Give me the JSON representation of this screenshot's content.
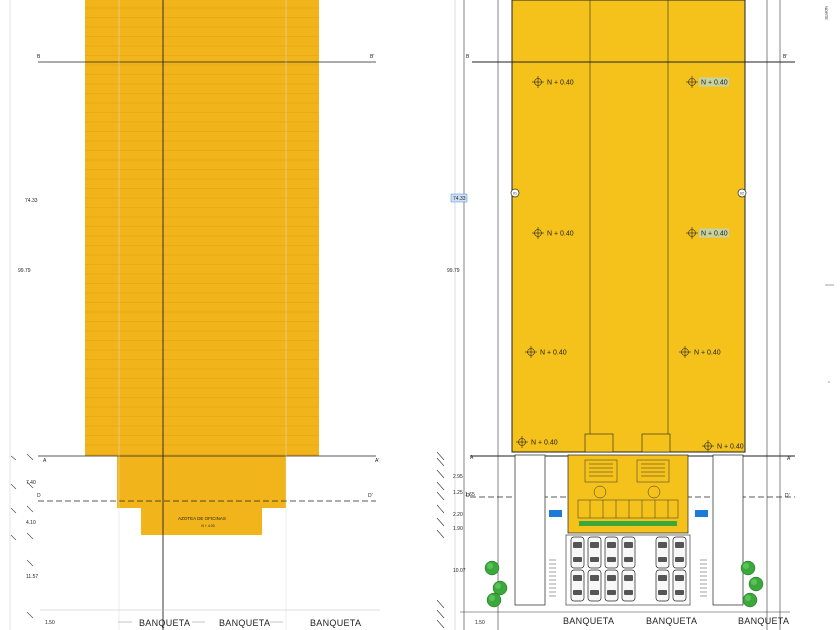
{
  "colors": {
    "roof_left": "#f2b41b",
    "roof_right": "#f4c21a",
    "line": "#222222",
    "highlight": "#c8d2a0",
    "sel_blue": "#1c7bd6",
    "tree_green": "#3aa83a"
  },
  "left_plan": {
    "section_marks": {
      "a": "A",
      "a_prime": "A'",
      "b": "B",
      "b_prime": "B'",
      "d": "D",
      "d_prime": "D'"
    },
    "dims": {
      "d1": "74.33",
      "d2": "99.79",
      "d3": "7.40",
      "d4": "4.10",
      "d5": "11.57",
      "d6": "1.50"
    },
    "office_roof_label": "AZOTEA DE OFICINAS",
    "office_roof_level": "N + 4.00",
    "sidewalk": [
      "BANQUETA",
      "BANQUETA",
      "BANQUETA"
    ]
  },
  "right_plan": {
    "section_marks": {
      "a": "A",
      "a_prime": "A'",
      "b": "B",
      "b_prime": "B'",
      "d": "D",
      "d_prime": "D'"
    },
    "dims": {
      "d1": "74.33",
      "d2": "99.79",
      "d3": "2.95",
      "d4": "1.25",
      "d5": "1.65",
      "d6": "2.20",
      "d7": "1.90",
      "d8": "10.07",
      "d9": "1.50"
    },
    "levels": [
      "N + 0.40",
      "N + 0.40",
      "N + 0.40",
      "N + 0.40",
      "N + 0.40",
      "N + 0.40",
      "N + 0.40",
      "N + 0.40"
    ],
    "side_marks": {
      "left": "01",
      "right": "02"
    },
    "sidewalk": [
      "BANQUETA",
      "BANQUETA",
      "BANQUETA"
    ]
  },
  "corner_label": "NORTE"
}
